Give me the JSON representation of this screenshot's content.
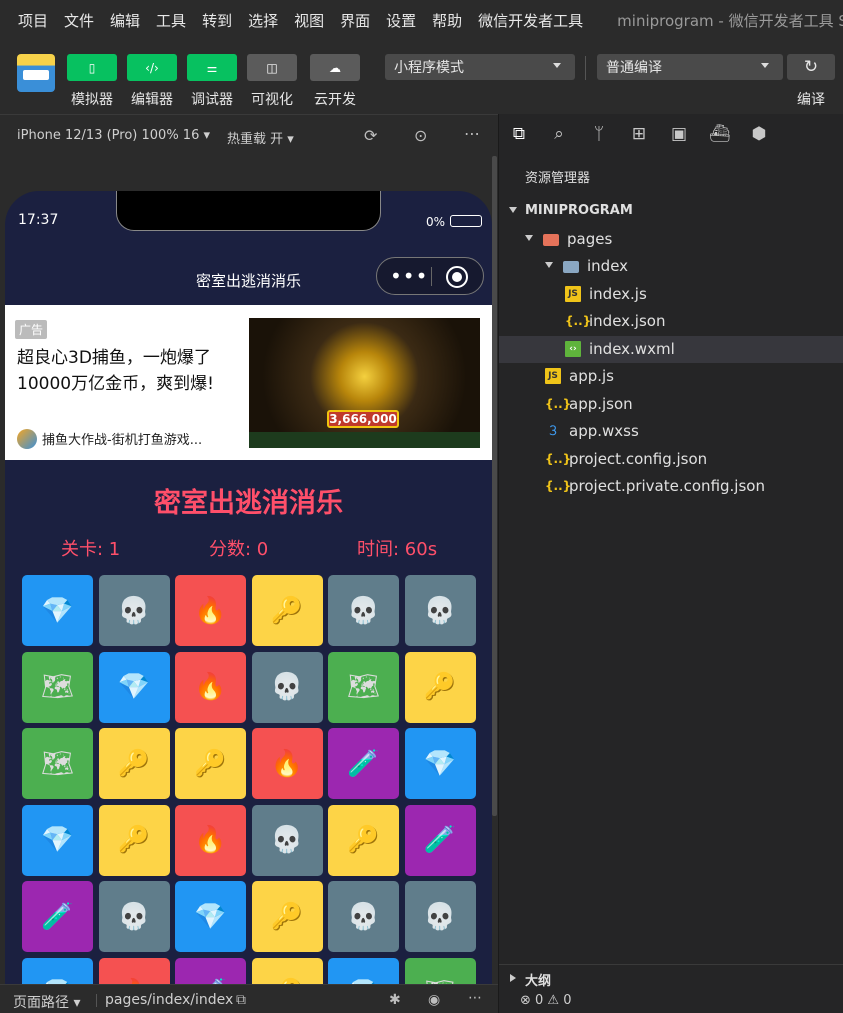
{
  "menubar": {
    "items": [
      "项目",
      "文件",
      "编辑",
      "工具",
      "转到",
      "选择",
      "视图",
      "界面",
      "设置",
      "帮助",
      "微信开发者工具"
    ],
    "window_title": "miniprogram - 微信开发者工具 S"
  },
  "toolbar": {
    "buttons": [
      {
        "label": "模拟器",
        "icon": "phone-icon"
      },
      {
        "label": "编辑器",
        "icon": "code-icon"
      },
      {
        "label": "调试器",
        "icon": "sliders-icon"
      },
      {
        "label": "可视化",
        "icon": "layout-icon"
      },
      {
        "label": "云开发",
        "icon": "cloud-icon"
      }
    ],
    "mode_select": "小程序模式",
    "compile_select": "普通编译",
    "compile_label": "编译"
  },
  "simulator": {
    "device": "iPhone 12/13 (Pro) 100% 16 ▾",
    "hot_reload": "热重载 开 ▾",
    "status_time": "17:37",
    "battery": "0%",
    "nav_title": "密室出逃消消乐",
    "capsule_dots": "•••"
  },
  "ad": {
    "tag": "广告",
    "title": "超良心3D捕鱼，一炮爆了10000万亿金币，爽到爆!",
    "source": "捕鱼大作战-街机打鱼游戏...",
    "image_score": "3,666,000"
  },
  "game": {
    "title": "密室出逃消消乐",
    "level": "关卡: 1",
    "score": "分数: 0",
    "time": "时间: 60s",
    "grid": [
      [
        "blue",
        "gray",
        "red",
        "yellow",
        "gray",
        "gray"
      ],
      [
        "green",
        "blue",
        "red",
        "gray",
        "green",
        "yellow"
      ],
      [
        "green",
        "yellow",
        "yellow",
        "red",
        "purple",
        "blue"
      ],
      [
        "blue",
        "yellow",
        "red",
        "gray",
        "yellow",
        "purple"
      ],
      [
        "purple",
        "gray",
        "blue",
        "yellow",
        "gray",
        "gray"
      ],
      [
        "blue",
        "red",
        "purple",
        "yellow",
        "blue",
        "green"
      ]
    ],
    "tile_icons": {
      "blue": "💎",
      "gray": "💀",
      "red": "🔥",
      "yellow": "🔑",
      "green": "🗺",
      "purple": "🧪"
    }
  },
  "statusbar": {
    "page_path_label": "页面路径 ▾",
    "path": "pages/index/index"
  },
  "explorer": {
    "title": "资源管理器",
    "root": "MINIPROGRAM",
    "files": [
      {
        "name": "pages",
        "type": "folder-red",
        "depth": 1,
        "open": true
      },
      {
        "name": "index",
        "type": "folder",
        "depth": 2,
        "open": true
      },
      {
        "name": "index.js",
        "type": "js",
        "depth": 3
      },
      {
        "name": "index.json",
        "type": "json",
        "depth": 3
      },
      {
        "name": "index.wxml",
        "type": "wxml",
        "depth": 3,
        "selected": true
      },
      {
        "name": "app.js",
        "type": "js",
        "depth": 2
      },
      {
        "name": "app.json",
        "type": "json",
        "depth": 2
      },
      {
        "name": "app.wxss",
        "type": "css",
        "depth": 2
      },
      {
        "name": "project.config.json",
        "type": "json",
        "depth": 2
      },
      {
        "name": "project.private.config.json",
        "type": "json",
        "depth": 2
      }
    ],
    "outline": "大纲",
    "problems": "⊗ 0 ⚠ 0"
  }
}
